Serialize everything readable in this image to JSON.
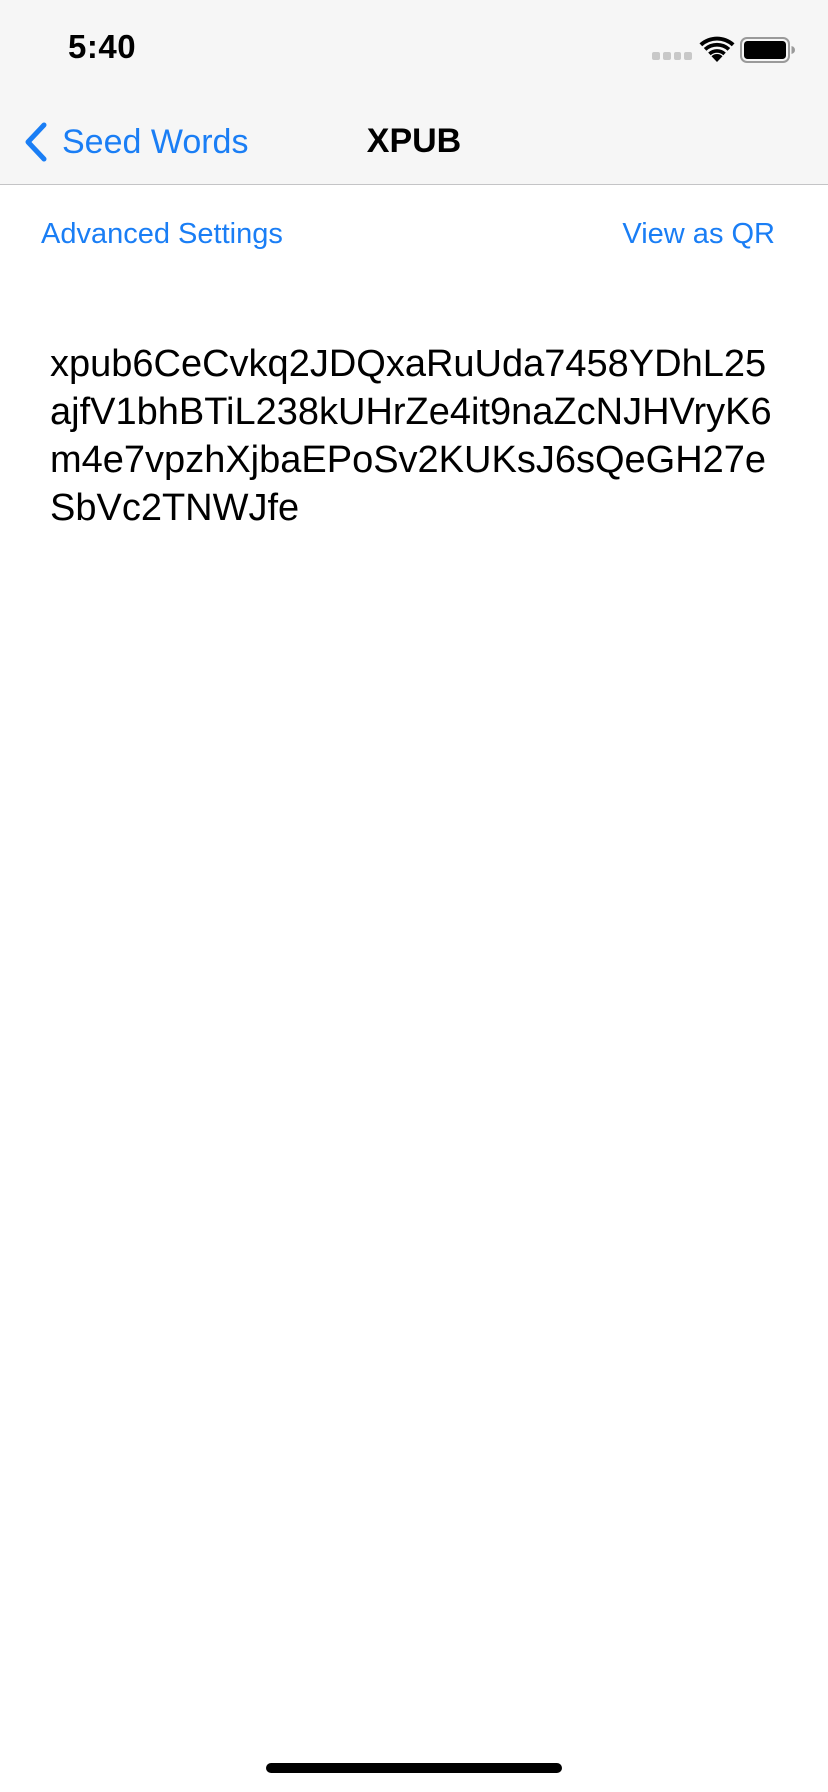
{
  "status_bar": {
    "time": "5:40",
    "signal_icon": "cellular-signal-icon",
    "wifi_icon": "wifi-icon",
    "battery_icon": "battery-icon"
  },
  "nav": {
    "back_label": "Seed Words",
    "back_icon": "chevron-left-icon",
    "title": "XPUB"
  },
  "actions": {
    "advanced_settings_label": "Advanced Settings",
    "view_qr_label": "View as QR"
  },
  "xpub": {
    "value": "xpub6CeCvkq2JDQxaRuUda7458YDhL25ajfV1bhBTiL238kUHrZe4it9naZcNJHVryK6m4e7vpzhXjbaEPoSv2KUKsJ6sQeGH27eSbVc2TNWJfe"
  },
  "colors": {
    "accent": "#1a7ef5",
    "nav_background": "#f6f6f6",
    "text": "#000000"
  }
}
